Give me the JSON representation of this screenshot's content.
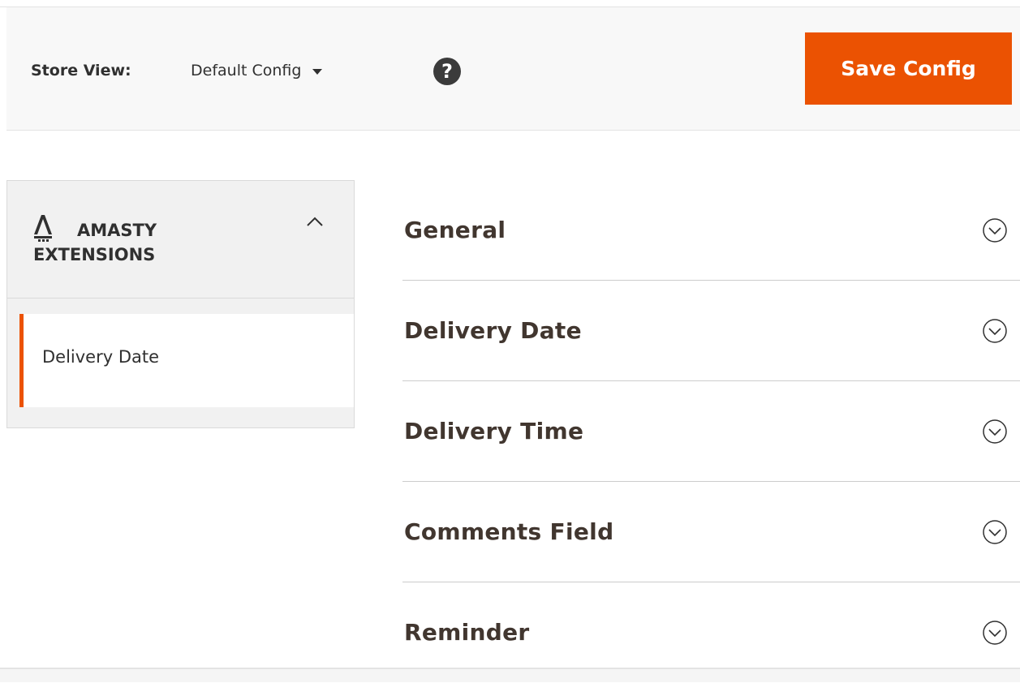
{
  "toolbar": {
    "store_view_label": "Store View:",
    "store_view_value": "Default Config",
    "save_label": "Save Config"
  },
  "sidebar": {
    "group_line1": "AMASTY",
    "group_line2": "EXTENSIONS",
    "items": [
      {
        "label": "Delivery Date"
      }
    ]
  },
  "sections": [
    {
      "title": "General"
    },
    {
      "title": "Delivery Date"
    },
    {
      "title": "Delivery Time"
    },
    {
      "title": "Comments Field"
    },
    {
      "title": "Reminder"
    }
  ],
  "colors": {
    "accent": "#eb5202",
    "toolbar_bg": "#f8f8f8",
    "sidebar_bg": "#f1f1f1",
    "text": "#303030"
  },
  "icons": [
    "caret-down-icon",
    "help-icon",
    "amasty-logo-icon",
    "chevron-up-icon",
    "expand-circle-icon"
  ]
}
